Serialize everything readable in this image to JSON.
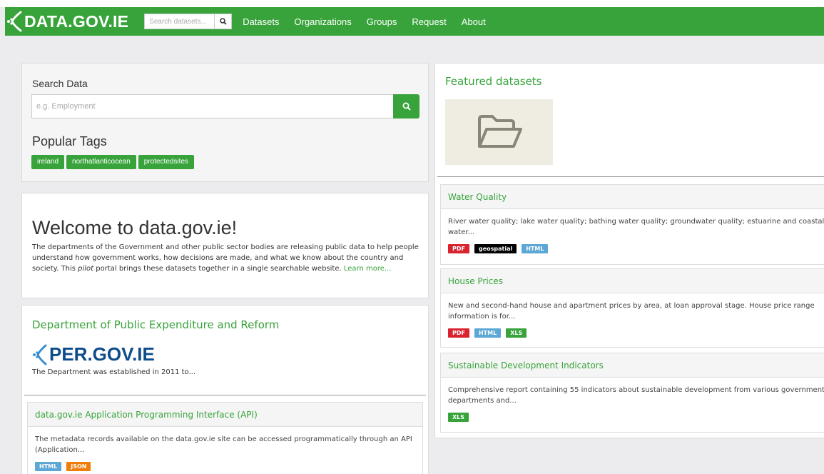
{
  "nav": {
    "logo_text": "DATA.GOV.IE",
    "search_placeholder": "Search datasets...",
    "links": [
      "Datasets",
      "Organizations",
      "Groups",
      "Request",
      "About"
    ]
  },
  "search_panel": {
    "label": "Search Data",
    "placeholder": "e.g. Employment",
    "tags_title": "Popular Tags",
    "tags": [
      "ireland",
      "northatlanticocean",
      "protectedsites"
    ]
  },
  "welcome": {
    "title": "Welcome to data.gov.ie!",
    "text_before": "The departments of the Government and other public sector bodies are releasing public data to help people understand how government works, how decisions are made, and what we know about the country and society. This ",
    "text_em": "pilot",
    "text_after": " portal brings these datasets together in a single searchable website. ",
    "link": "Learn more..."
  },
  "department": {
    "title": "Department of Public Expenditure and Reform",
    "logo_text": "PER.GOV.IE",
    "description": "The Department was established in 2011 to..."
  },
  "api_card": {
    "title": "data.gov.ie Application Programming Interface (API)",
    "text": "The metadata records available on the data.gov.ie site can be accessed programmatically through an API (Application...",
    "formats": [
      "HTML",
      "JSON"
    ]
  },
  "featured": {
    "title": "Featured datasets",
    "datasets": [
      {
        "title": "Water Quality",
        "text": "River water quality; lake water quality; bathing water quality; groundwater quality; estuarine and coastal water...",
        "formats": [
          "PDF",
          "geospatial",
          "HTML"
        ]
      },
      {
        "title": "House Prices",
        "text": "New and second-hand house and apartment prices by area, at loan approval stage. House price range information is for...",
        "formats": [
          "PDF",
          "HTML",
          "XLS"
        ]
      },
      {
        "title": "Sustainable Development Indicators",
        "text": "Comprehensive report containing 55 indicators about sustainable development from various government departments and...",
        "formats": [
          "XLS"
        ]
      }
    ]
  },
  "colors": {
    "brand_green": "#37a33a",
    "per_blue": "#0e4c8a",
    "pdf": "#d9232e",
    "geospatial": "#000000",
    "html": "#5ba7d6",
    "xls": "#37a33a",
    "json": "#ef7d0a"
  }
}
